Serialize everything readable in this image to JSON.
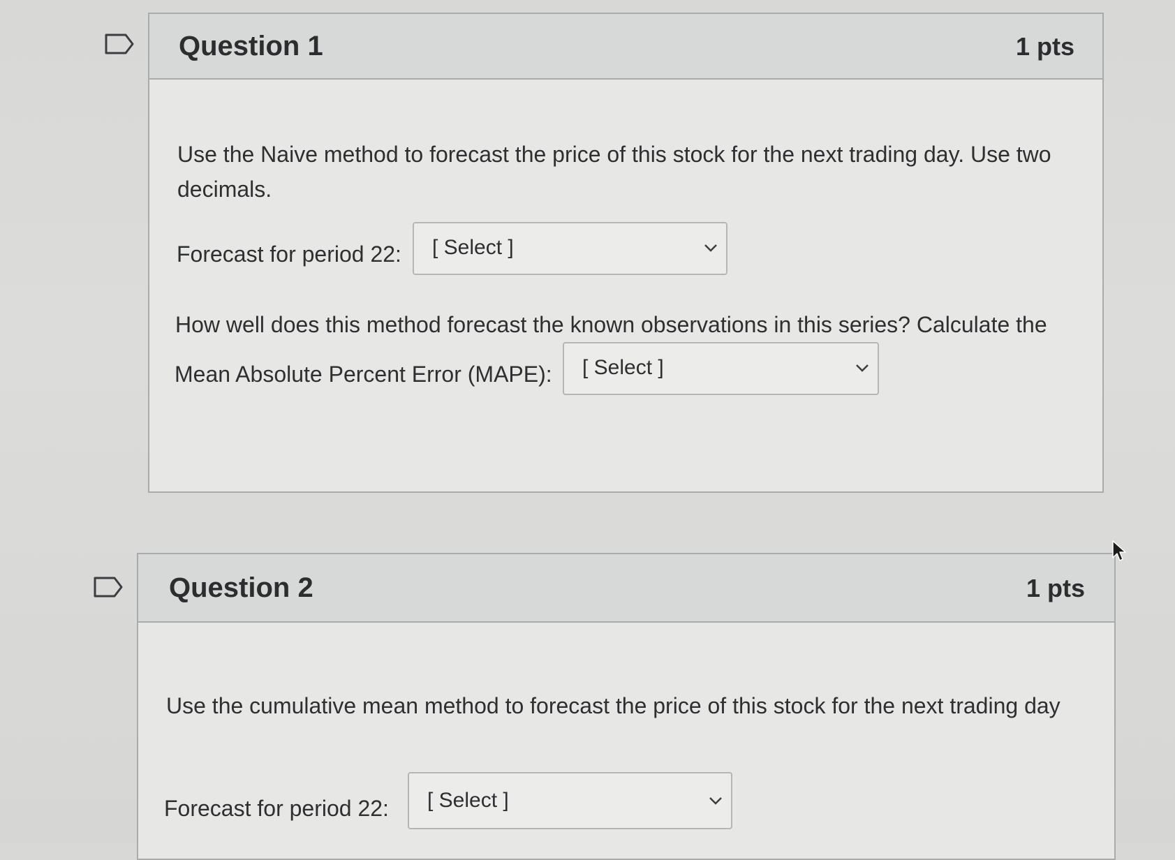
{
  "questions": [
    {
      "title": "Question 1",
      "points": "1 pts",
      "prompt": "Use the Naive method to forecast the price of this stock for the next trading day. Use two decimals.",
      "field1_label": "Forecast for period 22:",
      "field1_value": "[ Select ]",
      "prompt2": "How well does this method forecast the known observations in this series? Calculate the",
      "field2_label": "Mean Absolute Percent Error (MAPE):",
      "field2_value": "[ Select ]"
    },
    {
      "title": "Question 2",
      "points": "1 pts",
      "prompt": "Use the cumulative mean method to forecast the price of this stock for the next trading day",
      "field1_label": "Forecast for period 22:",
      "field1_value": "[ Select ]"
    }
  ],
  "icons": {
    "flag": "flag-question-icon",
    "dropdown": "chevron-down-icon",
    "cursor": "mouse-pointer-icon"
  },
  "colors": {
    "header_bg": "#d7d8d8",
    "body_bg": "#e7e7e5",
    "border": "#a9abad"
  }
}
